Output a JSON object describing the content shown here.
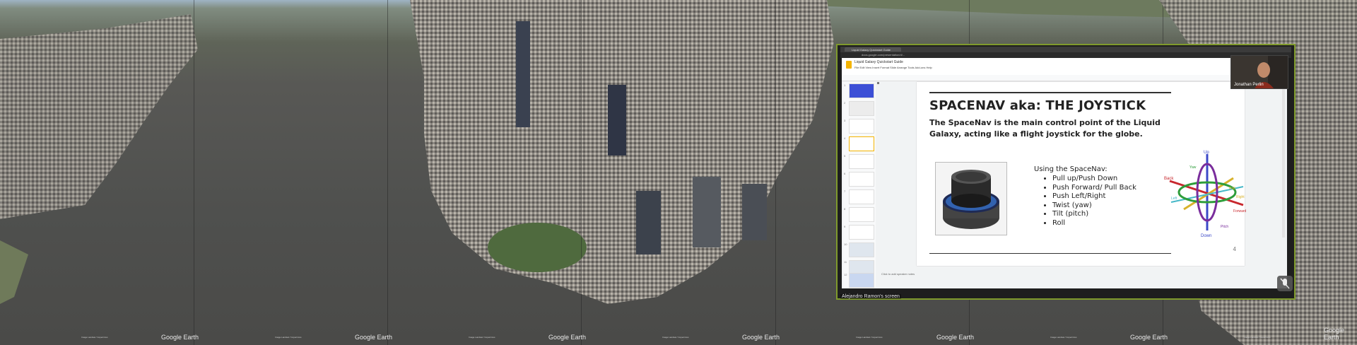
{
  "google_earth": {
    "watermark": "Google Earth",
    "panels": [
      {
        "credit": "Image Landsat / Copernicus"
      },
      {
        "credit": "Image Landsat / Copernicus"
      },
      {
        "credit": "Image Landsat / Copernicus"
      },
      {
        "credit": "Image Landsat / Copernicus"
      },
      {
        "credit": "Image Landsat / Copernicus"
      },
      {
        "credit": "Image Landsat / Copernicus"
      },
      {
        "credit": "Image Landsat / Copernicus"
      }
    ]
  },
  "meet": {
    "browser": {
      "tab_title": "Liquid Galaxy Quickstart Guide",
      "url": "docs.google.com/presentation/d/..."
    },
    "slides_app": {
      "doc_title": "Liquid Galaxy Quickstart Guide",
      "menu": "File  Edit  View  Insert  Format  Slide  Arrange  Tools  Add-ons  Help",
      "thumb_numbers": [
        "1",
        "2",
        "3",
        "4",
        "5",
        "6",
        "7",
        "8",
        "9",
        "10",
        "11",
        "12",
        "13"
      ],
      "notes_placeholder": "Click to add speaker notes"
    },
    "slide": {
      "title": "SPACENAV aka: THE JOYSTICK",
      "body": "The SpaceNav is the main control point of the Liquid Galaxy, acting like a flight joystick for the globe.",
      "list_intro": "Using the SpaceNav:",
      "bullets": [
        "Pull up/Push Down",
        "Push Forward/ Pull Back",
        "Push Left/Right",
        "Twist (yaw)",
        "Tilt (pitch)",
        "Roll"
      ],
      "page_number": "4",
      "axis_labels": {
        "up": "Up",
        "down": "Down",
        "back": "Back",
        "forward": "Forward",
        "left": "Left",
        "right": "Right",
        "yaw": "Yaw",
        "pitch": "Pitch",
        "roll": "Roll"
      }
    },
    "camera": {
      "name": "Jonathan Perlin"
    },
    "presenting": "Alejandro Ramon's screen"
  }
}
